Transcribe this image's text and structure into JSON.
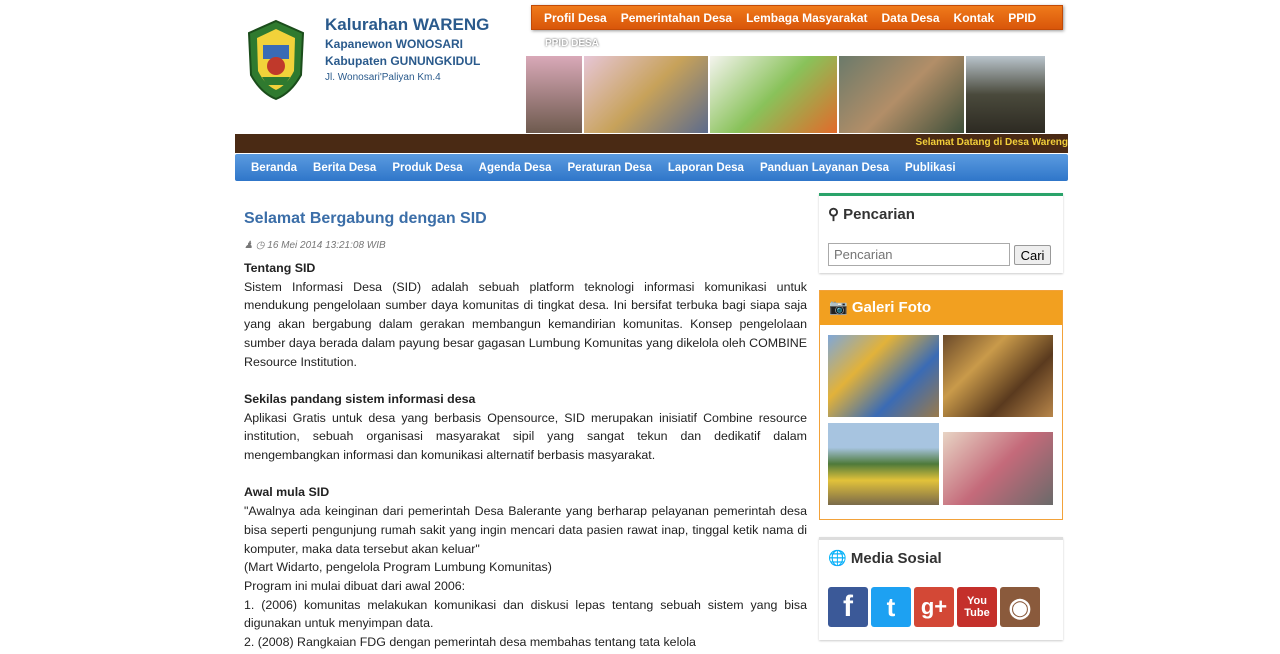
{
  "header": {
    "title": "Kalurahan WARENG",
    "line1": "Kapanewon WONOSARI",
    "line2": "Kabupaten GUNUNGKIDUL",
    "address": "Jl. Wonosari'Paliyan Km.4"
  },
  "top_menu": [
    "Profil Desa",
    "Pemerintahan Desa",
    "Lembaga Masyarakat",
    "Data Desa",
    "Kontak",
    "PPID"
  ],
  "banner_label": "PPID DESA",
  "marquee": "Selamat Datang di Desa Wareng",
  "main_menu": [
    "Beranda",
    "Berita Desa",
    "Produk Desa",
    "Agenda Desa",
    "Peraturan Desa",
    "Laporan Desa",
    "Panduan Layanan Desa",
    "Publikasi"
  ],
  "article": {
    "title": "Selamat Bergabung dengan SID",
    "date": "16 Mei 2014 13:21:08 WIB",
    "s1_head": "Tentang SID",
    "s1_text": "Sistem Informasi Desa (SID) adalah sebuah platform teknologi informasi komunikasi untuk mendukung pengelolaan sumber daya komunitas di tingkat desa. Ini bersifat terbuka bagi siapa saja yang akan bergabung dalam gerakan membangun kemandirian komunitas. Konsep pengelolaan sumber daya berada dalam payung besar gagasan Lumbung Komunitas yang dikelola oleh COMBINE Resource Institution.",
    "s2_head": "Sekilas pandang sistem informasi desa",
    "s2_text": "Aplikasi Gratis untuk desa yang berbasis Opensource, SID merupakan inisiatif Combine resource institution, sebuah organisasi masyarakat sipil yang sangat tekun dan dedikatif dalam mengembangkan informasi dan komunikasi alternatif berbasis masyarakat.",
    "s3_head": "Awal mula SID",
    "s3_quote": "\"Awalnya ada keinginan dari pemerintah Desa Balerante yang berharap pelayanan pemerintah desa bisa seperti pengunjung rumah sakit yang ingin mencari data pasien rawat inap, tinggal ketik nama di komputer, maka data tersebut akan keluar\"",
    "s3_author": "(Mart Widarto, pengelola Program Lumbung Komunitas)",
    "s3_intro": "Program ini mulai dibuat dari awal 2006:",
    "s3_item1": "1. (2006) komunitas melakukan komunikasi dan diskusi lepas tentang sebuah sistem yang bisa digunakan untuk menyimpan data.",
    "s3_item2": "2. (2008) Rangkaian FDG dengan pemerintah desa membahas tentang tata kelola"
  },
  "sidebar": {
    "search_title": "Pencarian",
    "search_placeholder": "Pencarian",
    "search_button": "Cari",
    "gallery_title": "Galeri Foto",
    "social_title": "Media Sosial",
    "social": [
      {
        "name": "facebook",
        "glyph": "f",
        "color": "#3b5998"
      },
      {
        "name": "twitter",
        "glyph": "t",
        "color": "#1da1f2"
      },
      {
        "name": "google-plus",
        "glyph": "g+",
        "color": "#d34836"
      },
      {
        "name": "youtube",
        "glyph": "You Tube",
        "color": "#c4302b"
      },
      {
        "name": "instagram",
        "glyph": "◉",
        "color": "#8a5a3c"
      }
    ]
  }
}
